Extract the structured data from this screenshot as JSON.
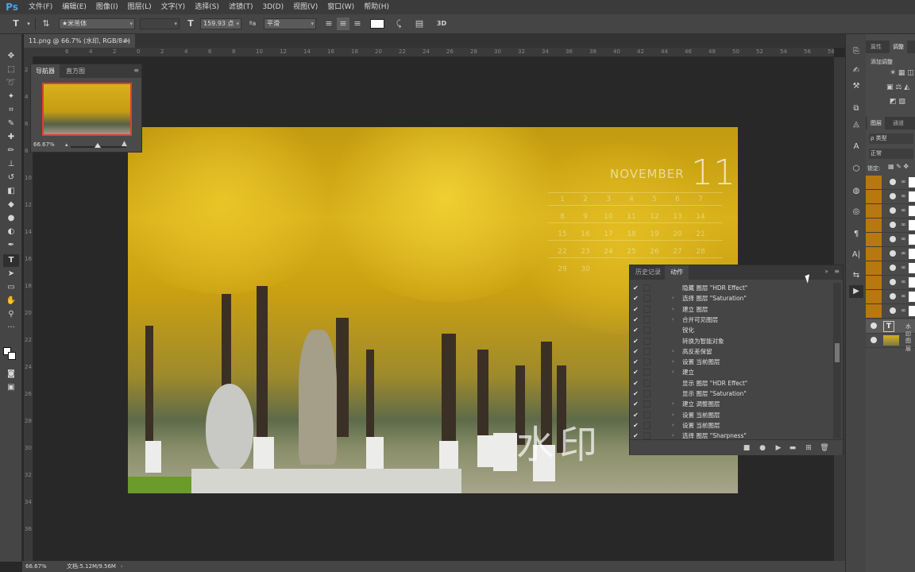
{
  "menubar": {
    "logo": "Ps",
    "items": [
      "文件(F)",
      "编辑(E)",
      "图像(I)",
      "图层(L)",
      "文字(Y)",
      "选择(S)",
      "滤镜(T)",
      "3D(D)",
      "视图(V)",
      "窗口(W)",
      "帮助(H)"
    ]
  },
  "options": {
    "font_family": "★米芾体",
    "font_size": "159.93 点",
    "antialias": "平滑",
    "tool_icon": "type-tool-icon"
  },
  "document": {
    "tab_title": "11.png @ 66.7% (水印, RGB/8#) *",
    "tab_close": "×"
  },
  "ruler": {
    "h_labels": [
      "6",
      "4",
      "2",
      "0",
      "2",
      "4",
      "6",
      "8",
      "10",
      "12",
      "14",
      "16",
      "18",
      "20",
      "22",
      "24",
      "26",
      "28",
      "30",
      "32",
      "34",
      "36",
      "38",
      "40",
      "42",
      "44",
      "46",
      "48",
      "50",
      "52",
      "54",
      "56",
      "58"
    ],
    "v_labels": [
      "2",
      "4",
      "6",
      "8",
      "10",
      "12",
      "14",
      "16",
      "18",
      "20",
      "22",
      "24",
      "26",
      "28",
      "30",
      "32",
      "34",
      "36"
    ]
  },
  "navigator": {
    "tabs": [
      "导航器",
      "直方图"
    ],
    "zoom": "66.67%"
  },
  "calendar": {
    "month": "NOVEMBER",
    "day": "11",
    "rows": [
      [
        "1",
        "2",
        "3",
        "4",
        "5",
        "6",
        "7"
      ],
      [
        "8",
        "9",
        "10",
        "11",
        "12",
        "13",
        "14"
      ],
      [
        "15",
        "16",
        "17",
        "18",
        "19",
        "20",
        "21"
      ],
      [
        "22",
        "23",
        "24",
        "25",
        "26",
        "27",
        "28"
      ],
      [
        "29",
        "30"
      ]
    ]
  },
  "watermark": "水印",
  "actions": {
    "tabs": [
      "历史记录",
      "动作"
    ],
    "items": [
      {
        "arrow": "",
        "text": "隐藏 图层 \"HDR Effect\""
      },
      {
        "arrow": "›",
        "text": "选择 图层 \"Saturation\""
      },
      {
        "arrow": "›",
        "text": "建立 图层"
      },
      {
        "arrow": "›",
        "text": "合并可见图层"
      },
      {
        "arrow": "",
        "text": "锐化"
      },
      {
        "arrow": "",
        "text": "转换为智能对象"
      },
      {
        "arrow": "›",
        "text": "高反差保留"
      },
      {
        "arrow": "›",
        "text": "设置 当前图层"
      },
      {
        "arrow": "›",
        "text": "建立"
      },
      {
        "arrow": "",
        "text": "显示 图层 \"HDR Effect\""
      },
      {
        "arrow": "",
        "text": "显示 图层 \"Saturation\""
      },
      {
        "arrow": "›",
        "text": "建立 调整图层"
      },
      {
        "arrow": "›",
        "text": "设置 当前图层"
      },
      {
        "arrow": "›",
        "text": "设置 当前图层"
      },
      {
        "arrow": "›",
        "text": "选择 图层 \"Sharpness\""
      }
    ]
  },
  "right_panel": {
    "top_tabs": [
      "属性",
      "调整"
    ],
    "add_adjust": "添加调整",
    "layer_tabs": [
      "图层",
      "通道"
    ],
    "kind": "ρ 类型",
    "blend": "正常",
    "lock": "锁定:",
    "text_layer": "水印",
    "image_layer": "图层"
  },
  "status": {
    "zoom": "66.67%",
    "doc": "文档:5.12M/9.56M"
  },
  "colors": {
    "orange_layer": "#b8770f",
    "nav_frame": "#e43c2f"
  }
}
